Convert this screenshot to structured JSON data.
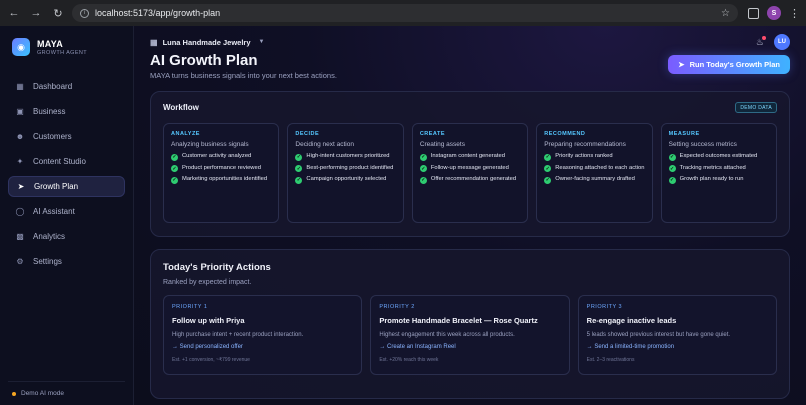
{
  "browser": {
    "url": "localhost:5173/app/growth-plan",
    "profile_initial": "S"
  },
  "brand": {
    "name": "MAYA",
    "tagline": "GROWTH AGENT"
  },
  "sidebar": {
    "items": [
      {
        "label": "Dashboard",
        "icon": "grid-icon"
      },
      {
        "label": "Business",
        "icon": "briefcase-icon"
      },
      {
        "label": "Customers",
        "icon": "users-icon"
      },
      {
        "label": "Content Studio",
        "icon": "sparkle-icon"
      },
      {
        "label": "Growth Plan",
        "icon": "rocket-icon",
        "active": true
      },
      {
        "label": "AI Assistant",
        "icon": "chat-icon"
      },
      {
        "label": "Analytics",
        "icon": "chart-icon"
      },
      {
        "label": "Settings",
        "icon": "gear-icon"
      }
    ],
    "footer": "Demo AI mode"
  },
  "topbar": {
    "org_name": "Luna Handmade Jewelry",
    "avatar_initials": "LU"
  },
  "page": {
    "title": "AI Growth Plan",
    "subtitle": "MAYA turns business signals into your next best actions.",
    "run_button": "Run Today's Growth Plan"
  },
  "workflow": {
    "title": "Workflow",
    "badge": "DEMO DATA",
    "stages": [
      {
        "tag": "ANALYZE",
        "title": "Analyzing business signals",
        "tasks": [
          "Customer activity analyzed",
          "Product performance reviewed",
          "Marketing opportunities identified"
        ]
      },
      {
        "tag": "DECIDE",
        "title": "Deciding next action",
        "tasks": [
          "High-intent customers prioritized",
          "Best-performing product identified",
          "Campaign opportunity selected"
        ]
      },
      {
        "tag": "CREATE",
        "title": "Creating assets",
        "tasks": [
          "Instagram content generated",
          "Follow-up message generated",
          "Offer recommendation generated"
        ]
      },
      {
        "tag": "RECOMMEND",
        "title": "Preparing recommendations",
        "tasks": [
          "Priority actions ranked",
          "Reasoning attached to each action",
          "Owner-facing summary drafted"
        ]
      },
      {
        "tag": "MEASURE",
        "title": "Setting success metrics",
        "tasks": [
          "Expected outcomes estimated",
          "Tracking metrics attached",
          "Growth plan ready to run"
        ]
      }
    ]
  },
  "priority": {
    "title": "Today's Priority Actions",
    "subtitle": "Ranked by expected impact.",
    "cards": [
      {
        "tag": "PRIORITY 1",
        "name": "Follow up with Priya",
        "desc": "High purchase intent + recent product interaction.",
        "link": "→ Send personalized offer",
        "foot": "Est. +1 conversion, ~₹799 revenue"
      },
      {
        "tag": "PRIORITY 2",
        "name": "Promote Handmade Bracelet — Rose Quartz",
        "desc": "Highest engagement this week across all products.",
        "link": "→ Create an Instagram Reel",
        "foot": "Est. +20% reach this week"
      },
      {
        "tag": "PRIORITY 3",
        "name": "Re-engage inactive leads",
        "desc": "5 leads showed previous interest but have gone quiet.",
        "link": "→ Send a limited-time promotion",
        "foot": "Est. 2–3 reactivations"
      }
    ]
  }
}
